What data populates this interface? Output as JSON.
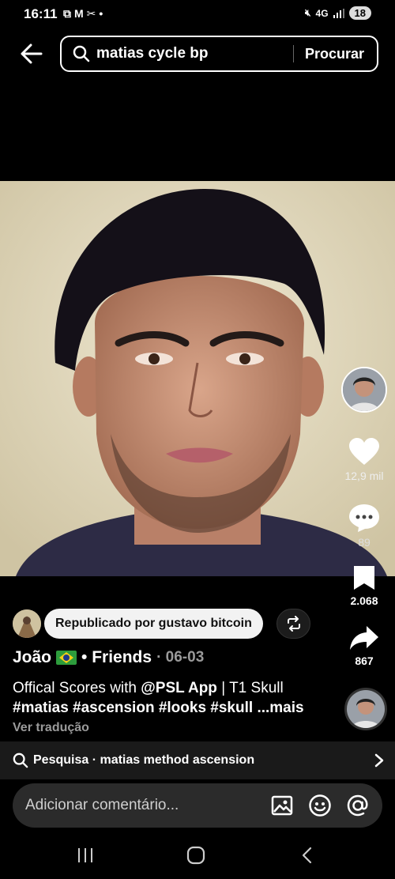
{
  "status_bar": {
    "time": "16:11",
    "network": "4G",
    "battery": "18"
  },
  "search": {
    "query": "matias cycle bp",
    "submit_label": "Procurar"
  },
  "actions": {
    "likes": "12,9 mil",
    "comments": "89",
    "favorites": "2.068",
    "shares": "867"
  },
  "repost": {
    "label": "Republicado por gustavo bitcoin"
  },
  "post": {
    "author": "João",
    "relation": "• Friends",
    "date": "· 06-03",
    "caption_prefix": "Offical Scores with ",
    "caption_mention": "@PSL App",
    "caption_suffix": " | T1 Skull",
    "hashtags": "#matias #ascension #looks #skull",
    "more_label": "...mais",
    "translate_label": "Ver tradução"
  },
  "related_search": {
    "label": "Pesquisa · matias method ascension"
  },
  "comment_input": {
    "placeholder": "Adicionar comentário..."
  },
  "colors": {
    "background": "#000000",
    "muted_text": "#9a9a9a",
    "flag_green": "#2d9c3c",
    "flag_yellow": "#f7d117"
  }
}
